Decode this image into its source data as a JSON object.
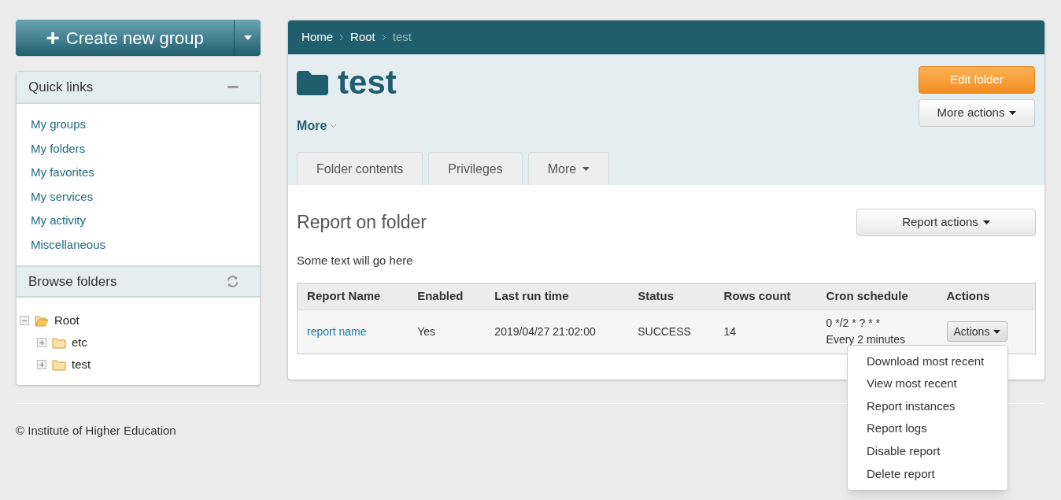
{
  "create_button": {
    "icon": "+",
    "label": "Create new group"
  },
  "quick_links": {
    "title": "Quick links",
    "links": [
      "My groups",
      "My folders",
      "My favorites",
      "My services",
      "My activity",
      "Miscellaneous"
    ]
  },
  "browse_folders": {
    "title": "Browse folders",
    "tree": [
      {
        "label": "Root",
        "expanded": true,
        "children": [
          {
            "label": "etc",
            "expanded": false
          },
          {
            "label": "test",
            "expanded": false
          }
        ]
      }
    ]
  },
  "breadcrumb": [
    {
      "label": "Home",
      "current": false
    },
    {
      "label": "Root",
      "current": false
    },
    {
      "label": "test",
      "current": true
    }
  ],
  "folder": {
    "title": "test",
    "more": "More",
    "edit_button": "Edit folder",
    "more_actions_button": "More actions"
  },
  "tabs": [
    {
      "label": "Folder contents",
      "has_caret": false
    },
    {
      "label": "Privileges",
      "has_caret": false
    },
    {
      "label": "More",
      "has_caret": true
    }
  ],
  "report": {
    "title": "Report on folder",
    "actions_button": "Report actions",
    "description": "Some text will go here",
    "table": {
      "columns": [
        "Report Name",
        "Enabled",
        "Last run time",
        "Status",
        "Rows count",
        "Cron schedule",
        "Actions"
      ],
      "rows": [
        {
          "name": "report name",
          "enabled": "Yes",
          "last_run": "2019/04/27 21:02:00",
          "status": "SUCCESS",
          "rows_count": "14",
          "cron": "0 */2 * ? * *",
          "cron_text": "Every 2 minutes",
          "actions": "Actions"
        }
      ]
    }
  },
  "actions_menu": [
    "Download most recent",
    "View most recent",
    "Report instances",
    "Report logs",
    "Disable report",
    "Delete report"
  ],
  "footer": "© Institute of Higher Education"
}
